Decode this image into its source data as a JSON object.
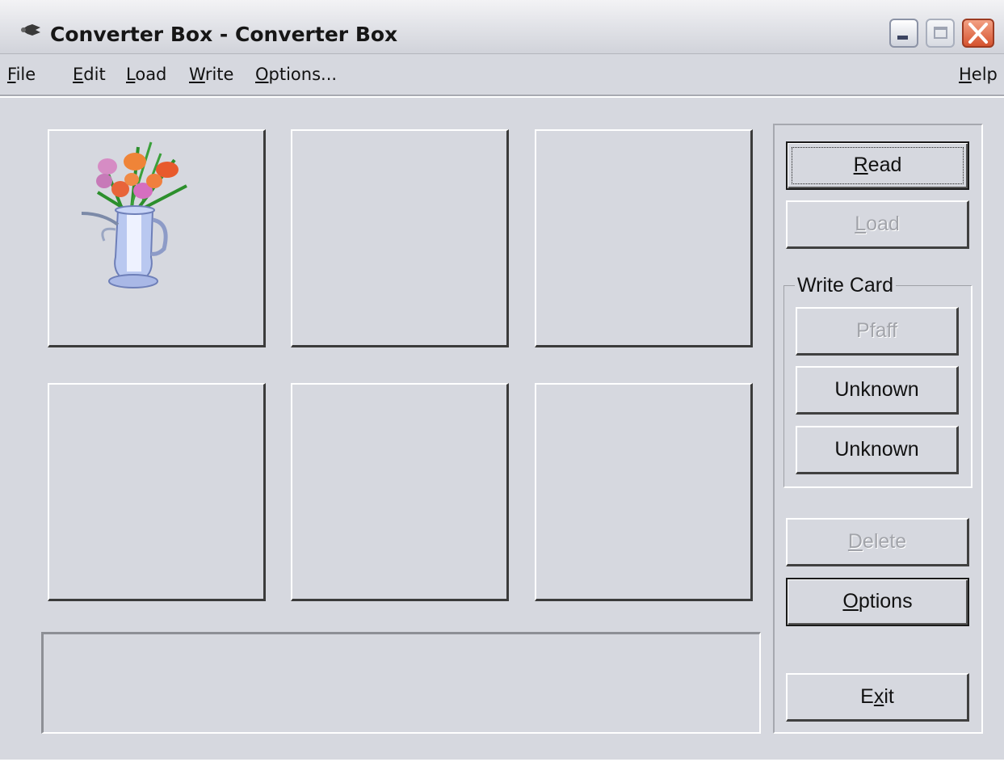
{
  "window": {
    "title": "Converter Box - Converter Box"
  },
  "menubar": {
    "file": {
      "acc": "F",
      "rest": "ile"
    },
    "edit": {
      "acc": "E",
      "rest": "dit"
    },
    "load": {
      "acc": "L",
      "rest": "oad"
    },
    "write": {
      "acc": "W",
      "rest": "rite"
    },
    "options": {
      "acc": "O",
      "rest": "ptions..."
    },
    "help": {
      "acc": "H",
      "rest": "elp"
    }
  },
  "panel": {
    "read": {
      "acc": "R",
      "rest": "ead"
    },
    "load": {
      "acc": "L",
      "rest": "oad"
    },
    "write_card": {
      "label": "Write Card",
      "pfaff": "Pfaff",
      "unknown_1": "Unknown",
      "unknown_2": "Unknown"
    },
    "delete": {
      "acc": "D",
      "rest": "elete"
    },
    "options": {
      "acc": "O",
      "rest": "ptions"
    },
    "exit": {
      "pre": "E",
      "acc": "x",
      "rest": "it"
    }
  },
  "icons": {
    "app": "mouse-icon",
    "thumbnail": "flower-vase-icon"
  },
  "colors": {
    "face": "#d6d8df",
    "close_button": "#d5532f"
  }
}
